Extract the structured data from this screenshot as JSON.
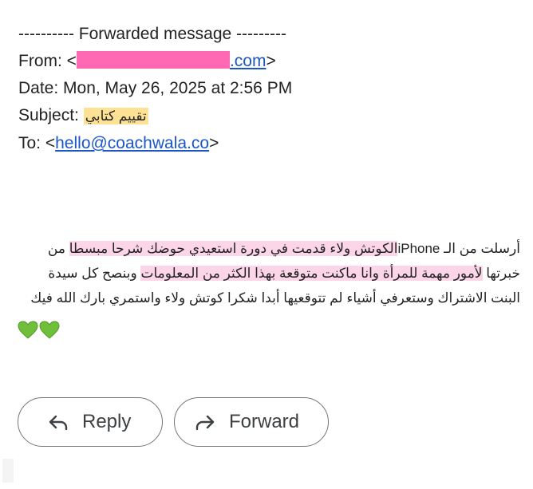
{
  "email": {
    "forward_header": "---------- Forwarded message ---------",
    "from_label": "From: <",
    "from_domain_suffix": ".com",
    "from_close": ">",
    "date_line": "Date: Mon, May 26, 2025 at 2:56 PM",
    "subject_label": "Subject: ",
    "subject_value": "تقييم كتابي",
    "to_label": "To: <",
    "to_email": "hello@coachwala.co",
    "to_close": ">"
  },
  "message": {
    "part1": "أرسلت من الـ ",
    "part2": "iPhone",
    "part3_highlight": "الكوتش ولاء قدمت في دورة استعيدي حوضك شرحا مبسطا",
    "part4": " من خبرتها ",
    "part5_highlight": "لأمور مهمة للمرأة وانا ماكنت متوقعة بهذا الكثر من المعلومات",
    "part6": " وبنصح كل سيدة البنت الاشتراك وستعرفي أشياء لم تتوقعيها أبدا شكرا كوتش ولاء واستمري بارك الله فيك"
  },
  "colors": {
    "heart": "#6fbf3a",
    "link": "#1a56c8",
    "subject_highlight": "#fde293",
    "body_highlight": "#fcd6e8",
    "redaction": "#ff69b4"
  },
  "hearts": [
    "green-heart-icon",
    "green-heart-icon"
  ],
  "actions": {
    "reply_label": "Reply",
    "forward_label": "Forward",
    "reply_icon": "reply-arrow-icon",
    "forward_icon": "forward-arrow-icon"
  }
}
